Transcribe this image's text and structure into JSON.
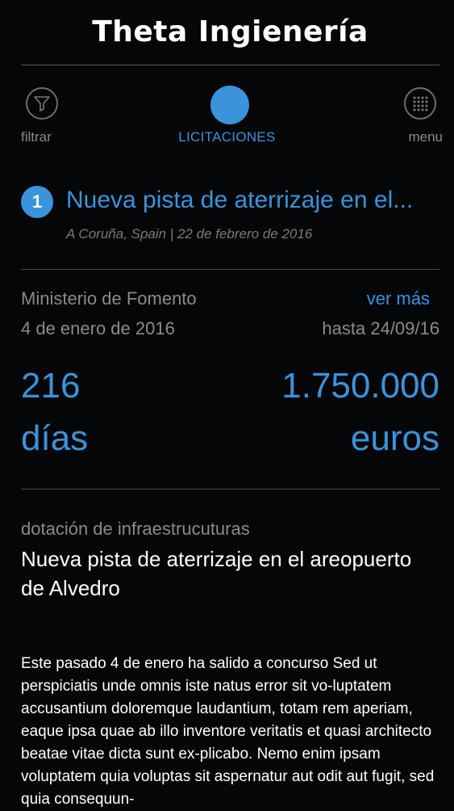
{
  "app": {
    "title": "Theta Ingienería"
  },
  "nav": {
    "filter_label": "filtrar",
    "tab_label": "LICITACIONES",
    "menu_label": "menu",
    "filter_icon": "funnel-icon",
    "menu_icon": "grid-dots-icon"
  },
  "item": {
    "number": "1",
    "title": "Nueva pista de aterrizaje en el...",
    "meta": "A Coruña, Spain | 22 de febrero de 2016",
    "organization": "Ministerio de Fomento",
    "more_link": "ver más",
    "start_date": "4 de enero de 2016",
    "deadline": "hasta 24/09/16",
    "days_value": "216",
    "days_unit": "días",
    "amount_value": "1.750.000",
    "amount_unit": "euros"
  },
  "detail": {
    "category": "dotación de infraestrucuturas",
    "headline": "Nueva pista de aterrizaje en el areopuerto de Alvedro",
    "body": "Este pasado 4 de enero ha salido a concurso Sed ut perspiciatis unde omnis iste natus error sit vo-luptatem accusantium doloremque laudantium, totam rem aperiam, eaque ipsa quae ab illo inventore veritatis et quasi architecto beatae vitae dicta sunt ex-plicabo. Nemo enim ipsam voluptatem quia voluptas sit aspernatur aut odit aut fugit, sed quia consequun-"
  },
  "colors": {
    "accent": "#3a93db",
    "background": "#050608",
    "muted": "#8a8a8a"
  }
}
